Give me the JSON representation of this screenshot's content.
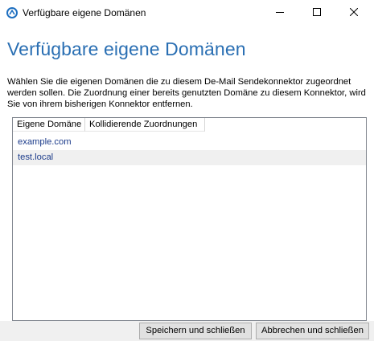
{
  "window": {
    "title": "Verfügbare eigene Domänen",
    "icon": "exchange-app-icon",
    "controls": {
      "minimize": "minimize-icon",
      "maximize": "maximize-icon",
      "close": "close-icon"
    }
  },
  "main": {
    "heading": "Verfügbare eigene Domänen",
    "description": "Wählen Sie die eigenen Domänen die zu diesem De-Mail Sendekonnektor zugeordnet werden sollen. Die Zuordnung einer bereits genutzten Domäne zu diesem Konnektor, wird Sie von ihrem bisherigen Konnektor entfernen."
  },
  "table": {
    "columns": [
      "Eigene Domäne",
      "Kollidierende Zuordnungen"
    ],
    "rows": [
      {
        "domain": "example.com",
        "conflict": ""
      },
      {
        "domain": "test.local",
        "conflict": ""
      }
    ]
  },
  "buttons": {
    "save": "Speichern und schließen",
    "cancel": "Abbrechen und schließen"
  },
  "colors": {
    "heading": "#2a6fb3",
    "row_text": "#1a3a8a",
    "selected_row": "#f0f0f0",
    "footer": "#f0f0f0"
  }
}
